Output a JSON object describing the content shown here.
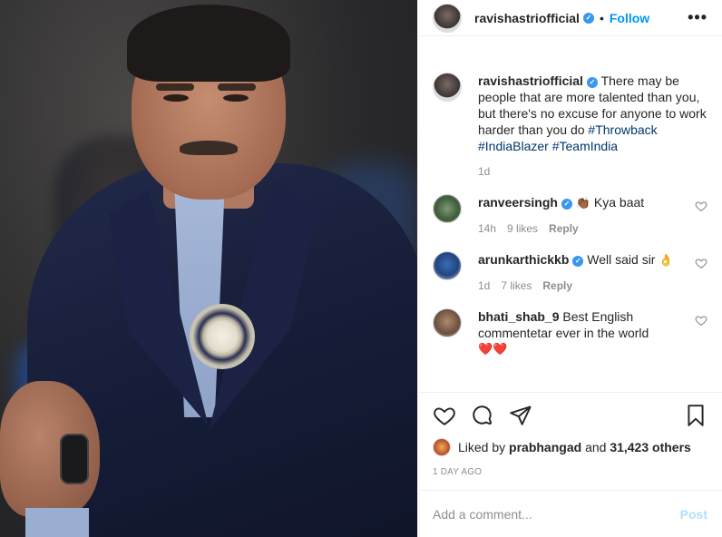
{
  "header": {
    "username": "ravishastriofficial",
    "separator": "•",
    "follow_label": "Follow",
    "more_label": "•••"
  },
  "caption": {
    "username": "ravishastriofficial",
    "text": "There may be people that are more talented than you, but there's no excuse for anyone to work harder than you do",
    "hashtags": [
      "#Throwback",
      "#IndiaBlazer",
      "#TeamIndia"
    ],
    "time": "1d"
  },
  "comments": [
    {
      "username": "ranveersingh",
      "verified": true,
      "text": "Kya baat",
      "emoji": "👏🏾",
      "time": "14h",
      "likes": "9 likes",
      "reply": "Reply"
    },
    {
      "username": "arunkarthickkb",
      "verified": true,
      "text": "Well said sir",
      "emoji": "👌",
      "time": "1d",
      "likes": "7 likes",
      "reply": "Reply"
    },
    {
      "username": "bhati_shab_9",
      "verified": false,
      "text": "Best English commentetar ever in the world",
      "emoji": "❤️❤️"
    }
  ],
  "likes": {
    "prefix": "Liked by",
    "user": "prabhangad",
    "middle": "and",
    "count": "31,423 others"
  },
  "timestamp": "1 DAY AGO",
  "add_comment": {
    "placeholder": "Add a comment...",
    "post_label": "Post"
  },
  "colors": {
    "accent": "#0095f6",
    "hashtag": "#00376b",
    "verified": "#3897f0",
    "muted": "#8e8e8e"
  },
  "icons": [
    "heart-icon",
    "comment-icon",
    "share-icon",
    "bookmark-icon",
    "verified-icon",
    "more-icon"
  ]
}
